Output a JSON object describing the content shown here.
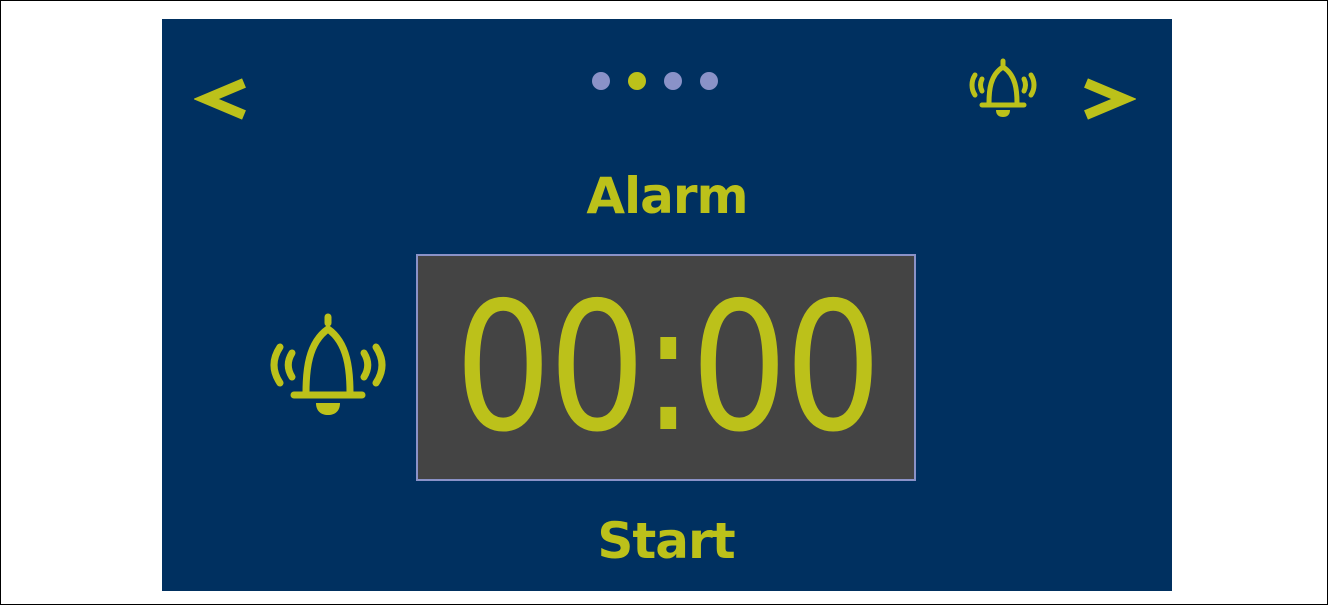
{
  "theme": {
    "background": "#003060",
    "accent": "#bcc11a",
    "dot_inactive": "#8a92c8",
    "display_background": "#444444",
    "display_border": "#8a92c8"
  },
  "nav": {
    "prev_icon": "chevron-left-icon",
    "next_icon": "chevron-right-icon",
    "alarm_icon": "bell-ringing-icon"
  },
  "pager": {
    "total": 4,
    "active_index": 1
  },
  "screen": {
    "title": "Alarm",
    "time": "00:00",
    "start_label": "Start",
    "bell_icon": "bell-ringing-icon"
  }
}
